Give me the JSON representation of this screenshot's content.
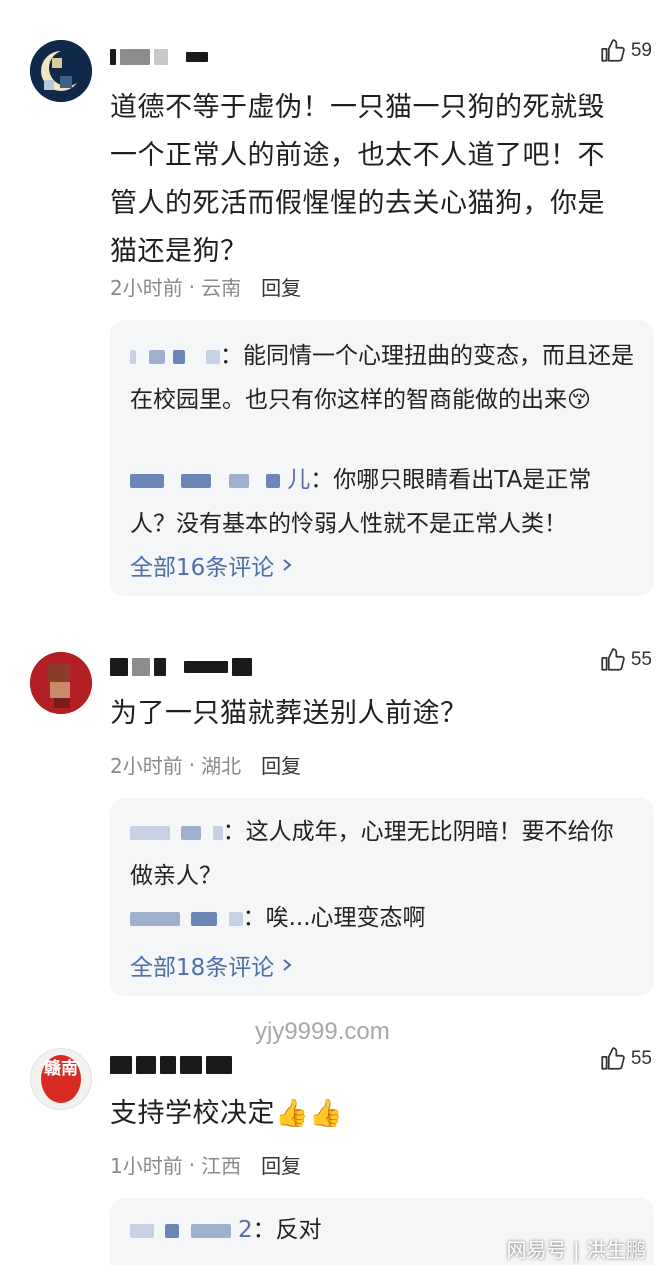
{
  "comments": [
    {
      "likes": "59",
      "text": "道德不等于虚伪！一只猫一只狗的死就毁一个正常人的前途，也太不人道了吧！不管人的死活而假惺惺的去关心猫狗，你是猫还是狗？",
      "time": "2小时前",
      "location": "云南",
      "reply_label": "回复",
      "replies": [
        {
          "text": "能同情一个心理扭曲的变态，而且还是在校园里。也只有你这样的智商能做的出来😚"
        },
        {
          "author_suffix": "儿",
          "text": "你哪只眼睛看出TA是正常人？没有基本的怜弱人性就不是正常人类！"
        }
      ],
      "view_all": "全部16条评论"
    },
    {
      "likes": "55",
      "text": "为了一只猫就葬送别人前途？",
      "time": "2小时前",
      "location": "湖北",
      "reply_label": "回复",
      "replies": [
        {
          "text": "这人成年，心理无比阴暗！要不给你做亲人？"
        },
        {
          "text": "唉...心理变态啊"
        }
      ],
      "view_all": "全部18条评论"
    },
    {
      "likes": "55",
      "avatar_text": "赣南",
      "text": "支持学校决定👍👍",
      "time": "1小时前",
      "location": "江西",
      "reply_label": "回复",
      "replies": [
        {
          "author_suffix": "2",
          "text": "反对"
        }
      ]
    }
  ],
  "watermark": "yjy9999.com",
  "source": "网易号 | 洪生鹏",
  "colors": {
    "link": "#4d6ea8",
    "meta": "#8a8a8a",
    "reply_bg": "#f5f6f8"
  }
}
